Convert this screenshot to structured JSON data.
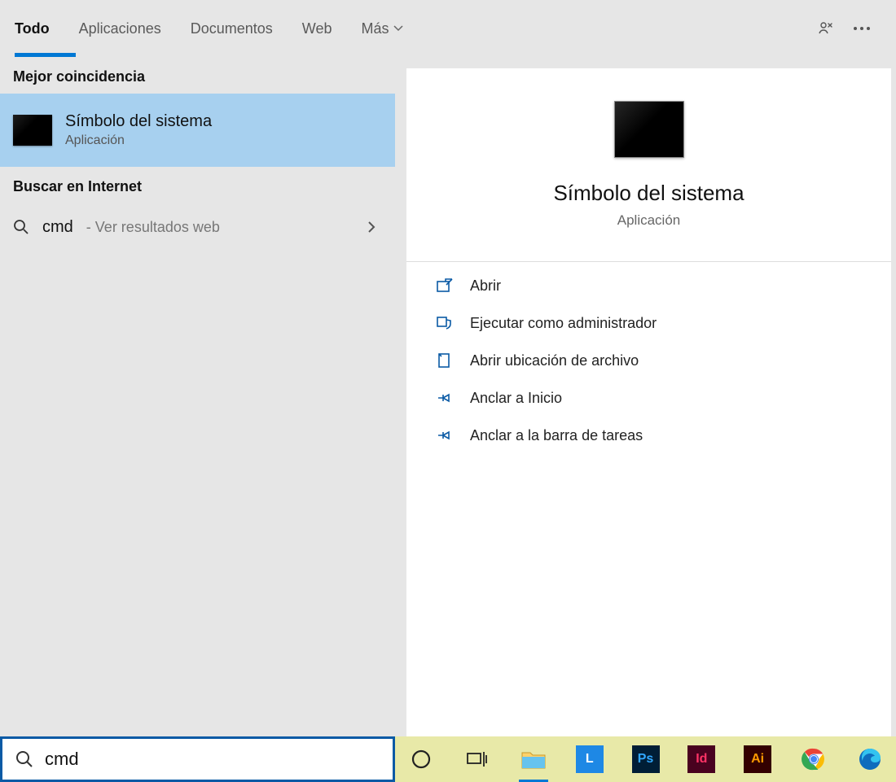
{
  "tabs": {
    "all": "Todo",
    "apps": "Aplicaciones",
    "docs": "Documentos",
    "web": "Web",
    "more": "Más"
  },
  "left": {
    "best_match_header": "Mejor coincidencia",
    "result": {
      "title": "Símbolo del sistema",
      "subtitle": "Aplicación"
    },
    "web_header": "Buscar en Internet",
    "web_item": {
      "term": "cmd",
      "hint": "- Ver resultados web"
    }
  },
  "detail": {
    "title": "Símbolo del sistema",
    "subtitle": "Aplicación",
    "actions": {
      "open": "Abrir",
      "admin": "Ejecutar como administrador",
      "location": "Abrir ubicación de archivo",
      "pin_start": "Anclar a Inicio",
      "pin_taskbar": "Anclar a la barra de tareas"
    }
  },
  "searchbox": {
    "value": "cmd"
  },
  "taskbar": {
    "ps": "Ps",
    "id": "Id",
    "ai": "Ai",
    "l": "L"
  }
}
